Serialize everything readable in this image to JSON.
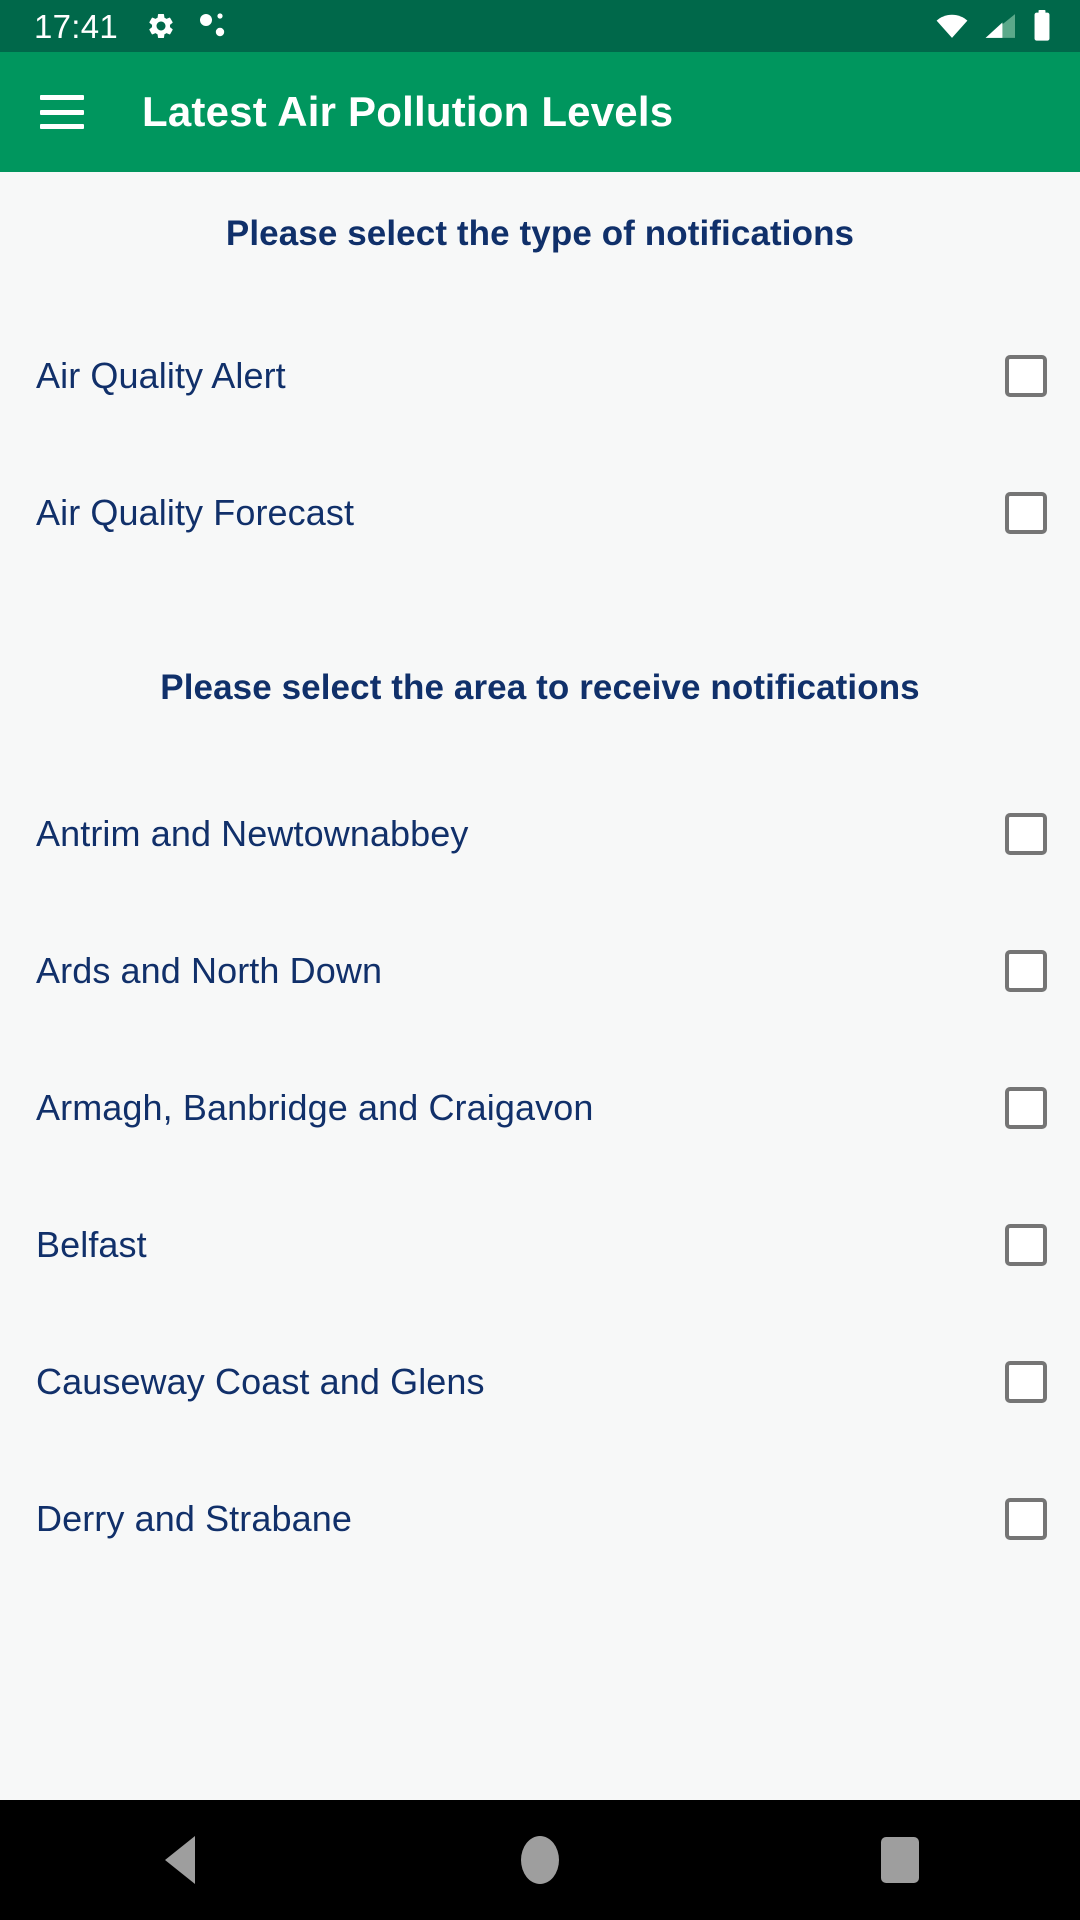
{
  "status_bar": {
    "time": "17:41",
    "left_icons": [
      "gear-icon",
      "bluetooth-dots-icon"
    ],
    "right_icons": [
      "wifi-icon",
      "cellular-signal-icon",
      "battery-icon"
    ],
    "background_color": "#00684A",
    "foreground_color": "#FFFFFF"
  },
  "app_bar": {
    "menu_icon": "hamburger-menu-icon",
    "title": "Latest Air Pollution Levels",
    "background_color": "#00965E",
    "title_color": "#FFFFFF"
  },
  "theme": {
    "page_background": "#F7F8F8",
    "text_color": "#11306A",
    "heading_color": "#10306A",
    "checkbox_border": "#757575",
    "checkbox_fill": "#FFFFFF"
  },
  "notification_section": {
    "heading": "Please select the type of notifications",
    "options": [
      {
        "label": "Air Quality Alert",
        "checked": false
      },
      {
        "label": "Air Quality Forecast",
        "checked": false
      }
    ]
  },
  "area_section": {
    "heading": "Please select the area to receive notifications",
    "options": [
      {
        "label": "Antrim and Newtownabbey",
        "checked": false
      },
      {
        "label": "Ards and North Down",
        "checked": false
      },
      {
        "label": "Armagh, Banbridge and Craigavon",
        "checked": false
      },
      {
        "label": "Belfast",
        "checked": false
      },
      {
        "label": "Causeway Coast and Glens",
        "checked": false
      },
      {
        "label": "Derry and Strabane",
        "checked": false
      }
    ]
  },
  "nav_bar": {
    "buttons": [
      {
        "name": "back-button",
        "icon": "triangle-left-icon"
      },
      {
        "name": "home-button",
        "icon": "circle-icon"
      },
      {
        "name": "recents-button",
        "icon": "square-icon"
      }
    ],
    "background_color": "#000000",
    "icon_color": "#9E9E9E"
  }
}
